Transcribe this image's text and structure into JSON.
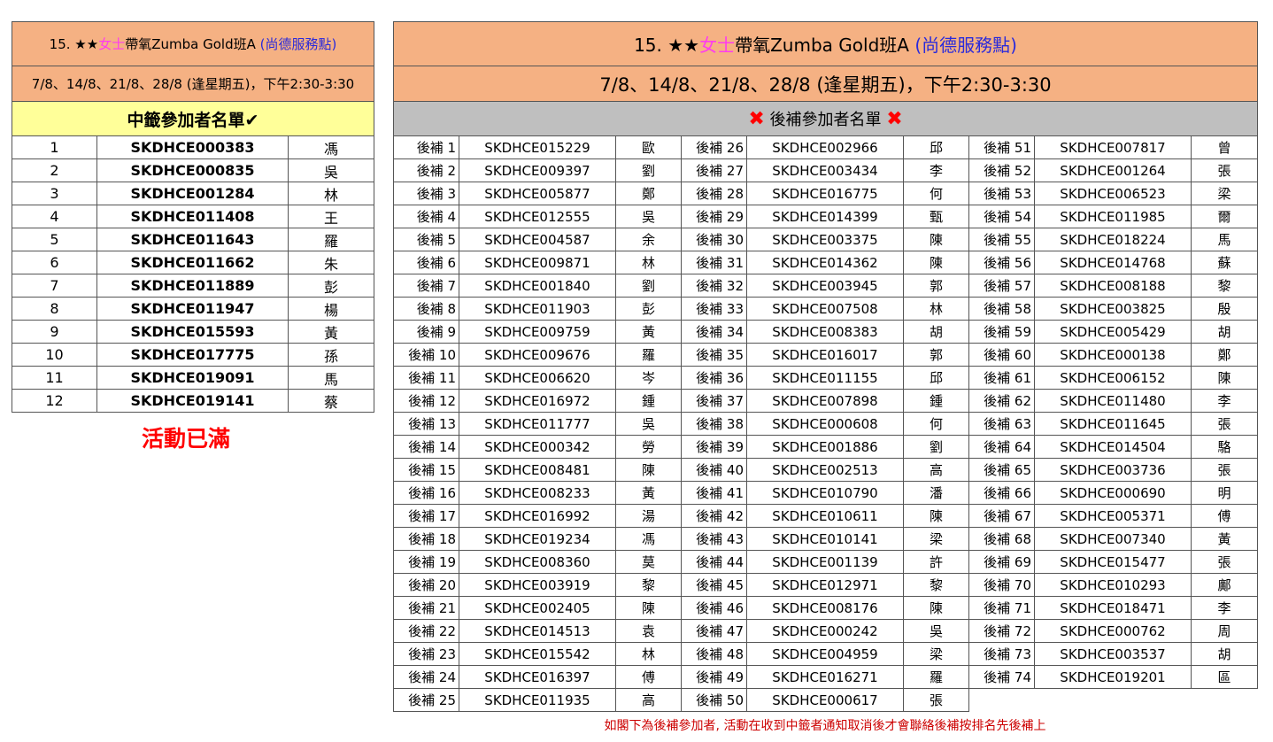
{
  "header": {
    "number": "15.",
    "stars": "★★",
    "women": "女士",
    "course": "帶氧Zumba Gold班A",
    "location": "(尚德服務點)",
    "dates": "7/8、14/8、21/8、28/8 (逢星期五)，下午2:30-3:30"
  },
  "winners": {
    "heading": "中籤參加者名單",
    "check": "✔",
    "rows": [
      {
        "no": "1",
        "code": "SKDHCE000383",
        "name": "馮"
      },
      {
        "no": "2",
        "code": "SKDHCE000835",
        "name": "吳"
      },
      {
        "no": "3",
        "code": "SKDHCE001284",
        "name": "林"
      },
      {
        "no": "4",
        "code": "SKDHCE011408",
        "name": "王"
      },
      {
        "no": "5",
        "code": "SKDHCE011643",
        "name": "羅"
      },
      {
        "no": "6",
        "code": "SKDHCE011662",
        "name": "朱"
      },
      {
        "no": "7",
        "code": "SKDHCE011889",
        "name": "彭"
      },
      {
        "no": "8",
        "code": "SKDHCE011947",
        "name": "楊"
      },
      {
        "no": "9",
        "code": "SKDHCE015593",
        "name": "黃"
      },
      {
        "no": "10",
        "code": "SKDHCE017775",
        "name": "孫"
      },
      {
        "no": "11",
        "code": "SKDHCE019091",
        "name": "馬"
      },
      {
        "no": "12",
        "code": "SKDHCE019141",
        "name": "蔡"
      }
    ],
    "full_label": "活動已滿"
  },
  "waitlist": {
    "heading": "後補參加者名單",
    "cross": "✖",
    "columns": [
      [
        {
          "no": "後補 1",
          "code": "SKDHCE015229",
          "name": "歐"
        },
        {
          "no": "後補 2",
          "code": "SKDHCE009397",
          "name": "劉"
        },
        {
          "no": "後補 3",
          "code": "SKDHCE005877",
          "name": "鄭"
        },
        {
          "no": "後補 4",
          "code": "SKDHCE012555",
          "name": "吳"
        },
        {
          "no": "後補 5",
          "code": "SKDHCE004587",
          "name": "余"
        },
        {
          "no": "後補 6",
          "code": "SKDHCE009871",
          "name": "林"
        },
        {
          "no": "後補 7",
          "code": "SKDHCE001840",
          "name": "劉"
        },
        {
          "no": "後補 8",
          "code": "SKDHCE011903",
          "name": "彭"
        },
        {
          "no": "後補 9",
          "code": "SKDHCE009759",
          "name": "黃"
        },
        {
          "no": "後補 10",
          "code": "SKDHCE009676",
          "name": "羅"
        },
        {
          "no": "後補 11",
          "code": "SKDHCE006620",
          "name": "岑"
        },
        {
          "no": "後補 12",
          "code": "SKDHCE016972",
          "name": "鍾"
        },
        {
          "no": "後補 13",
          "code": "SKDHCE011777",
          "name": "吳"
        },
        {
          "no": "後補 14",
          "code": "SKDHCE000342",
          "name": "勞"
        },
        {
          "no": "後補 15",
          "code": "SKDHCE008481",
          "name": "陳"
        },
        {
          "no": "後補 16",
          "code": "SKDHCE008233",
          "name": "黃"
        },
        {
          "no": "後補 17",
          "code": "SKDHCE016992",
          "name": "湯"
        },
        {
          "no": "後補 18",
          "code": "SKDHCE019234",
          "name": "馮"
        },
        {
          "no": "後補 19",
          "code": "SKDHCE008360",
          "name": "莫"
        },
        {
          "no": "後補 20",
          "code": "SKDHCE003919",
          "name": "黎"
        },
        {
          "no": "後補 21",
          "code": "SKDHCE002405",
          "name": "陳"
        },
        {
          "no": "後補 22",
          "code": "SKDHCE014513",
          "name": "袁"
        },
        {
          "no": "後補 23",
          "code": "SKDHCE015542",
          "name": "林"
        },
        {
          "no": "後補 24",
          "code": "SKDHCE016397",
          "name": "傅"
        },
        {
          "no": "後補 25",
          "code": "SKDHCE011935",
          "name": "高"
        }
      ],
      [
        {
          "no": "後補 26",
          "code": "SKDHCE002966",
          "name": "邱"
        },
        {
          "no": "後補 27",
          "code": "SKDHCE003434",
          "name": "李"
        },
        {
          "no": "後補 28",
          "code": "SKDHCE016775",
          "name": "何"
        },
        {
          "no": "後補 29",
          "code": "SKDHCE014399",
          "name": "甄"
        },
        {
          "no": "後補 30",
          "code": "SKDHCE003375",
          "name": "陳"
        },
        {
          "no": "後補 31",
          "code": "SKDHCE014362",
          "name": "陳"
        },
        {
          "no": "後補 32",
          "code": "SKDHCE003945",
          "name": "郭"
        },
        {
          "no": "後補 33",
          "code": "SKDHCE007508",
          "name": "林"
        },
        {
          "no": "後補 34",
          "code": "SKDHCE008383",
          "name": "胡"
        },
        {
          "no": "後補 35",
          "code": "SKDHCE016017",
          "name": "郭"
        },
        {
          "no": "後補 36",
          "code": "SKDHCE011155",
          "name": "邱"
        },
        {
          "no": "後補 37",
          "code": "SKDHCE007898",
          "name": "鍾"
        },
        {
          "no": "後補 38",
          "code": "SKDHCE000608",
          "name": "何"
        },
        {
          "no": "後補 39",
          "code": "SKDHCE001886",
          "name": "劉"
        },
        {
          "no": "後補 40",
          "code": "SKDHCE002513",
          "name": "高"
        },
        {
          "no": "後補 41",
          "code": "SKDHCE010790",
          "name": "潘"
        },
        {
          "no": "後補 42",
          "code": "SKDHCE010611",
          "name": "陳"
        },
        {
          "no": "後補 43",
          "code": "SKDHCE010141",
          "name": "梁"
        },
        {
          "no": "後補 44",
          "code": "SKDHCE001139",
          "name": "許"
        },
        {
          "no": "後補 45",
          "code": "SKDHCE012971",
          "name": "黎"
        },
        {
          "no": "後補 46",
          "code": "SKDHCE008176",
          "name": "陳"
        },
        {
          "no": "後補 47",
          "code": "SKDHCE000242",
          "name": "吳"
        },
        {
          "no": "後補 48",
          "code": "SKDHCE004959",
          "name": "梁"
        },
        {
          "no": "後補 49",
          "code": "SKDHCE016271",
          "name": "羅"
        },
        {
          "no": "後補 50",
          "code": "SKDHCE000617",
          "name": "張"
        }
      ],
      [
        {
          "no": "後補 51",
          "code": "SKDHCE007817",
          "name": "曾"
        },
        {
          "no": "後補 52",
          "code": "SKDHCE001264",
          "name": "張"
        },
        {
          "no": "後補 53",
          "code": "SKDHCE006523",
          "name": "梁"
        },
        {
          "no": "後補 54",
          "code": "SKDHCE011985",
          "name": "爾"
        },
        {
          "no": "後補 55",
          "code": "SKDHCE018224",
          "name": "馬"
        },
        {
          "no": "後補 56",
          "code": "SKDHCE014768",
          "name": "蘇"
        },
        {
          "no": "後補 57",
          "code": "SKDHCE008188",
          "name": "黎"
        },
        {
          "no": "後補 58",
          "code": "SKDHCE003825",
          "name": "殷"
        },
        {
          "no": "後補 59",
          "code": "SKDHCE005429",
          "name": "胡"
        },
        {
          "no": "後補 60",
          "code": "SKDHCE000138",
          "name": "鄭"
        },
        {
          "no": "後補 61",
          "code": "SKDHCE006152",
          "name": "陳"
        },
        {
          "no": "後補 62",
          "code": "SKDHCE011480",
          "name": "李"
        },
        {
          "no": "後補 63",
          "code": "SKDHCE011645",
          "name": "張"
        },
        {
          "no": "後補 64",
          "code": "SKDHCE014504",
          "name": "駱"
        },
        {
          "no": "後補 65",
          "code": "SKDHCE003736",
          "name": "張"
        },
        {
          "no": "後補 66",
          "code": "SKDHCE000690",
          "name": "明"
        },
        {
          "no": "後補 67",
          "code": "SKDHCE005371",
          "name": "傅"
        },
        {
          "no": "後補 68",
          "code": "SKDHCE007340",
          "name": "黃"
        },
        {
          "no": "後補 69",
          "code": "SKDHCE015477",
          "name": "張"
        },
        {
          "no": "後補 70",
          "code": "SKDHCE010293",
          "name": "鄺"
        },
        {
          "no": "後補 71",
          "code": "SKDHCE018471",
          "name": "李"
        },
        {
          "no": "後補 72",
          "code": "SKDHCE000762",
          "name": "周"
        },
        {
          "no": "後補 73",
          "code": "SKDHCE003537",
          "name": "胡"
        },
        {
          "no": "後補 74",
          "code": "SKDHCE019201",
          "name": "區"
        }
      ]
    ],
    "note": "如閣下為後補參加者, 活動在收到中籤者通知取消後才會聯絡後補按排名先後補上"
  }
}
